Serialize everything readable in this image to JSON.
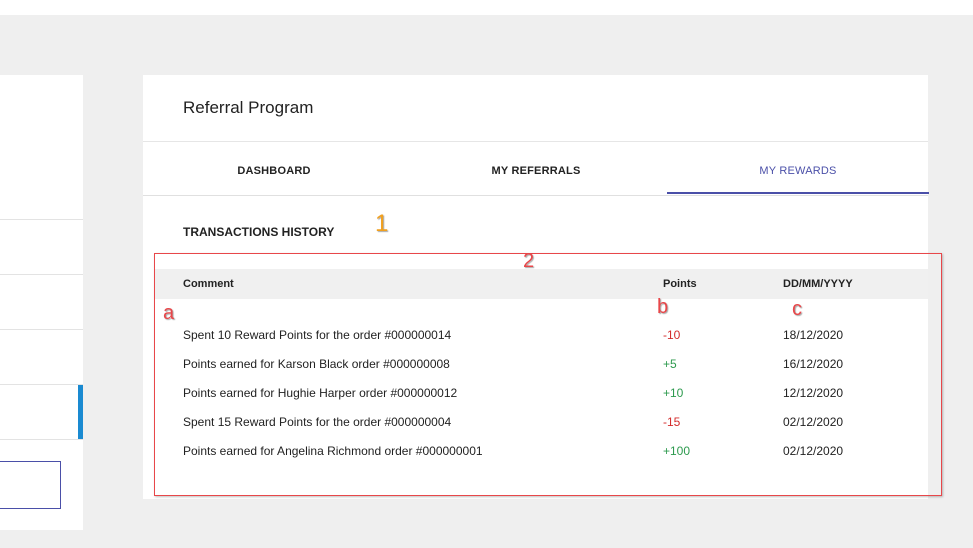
{
  "card": {
    "title": "Referral Program"
  },
  "tabs": [
    {
      "label": "DASHBOARD"
    },
    {
      "label": "MY REFERRALS"
    },
    {
      "label": "MY REWARDS"
    }
  ],
  "section": {
    "title": "TRANSACTIONS HISTORY"
  },
  "table": {
    "headers": {
      "comment": "Comment",
      "points": "Points",
      "date": "DD/MM/YYYY"
    },
    "rows": [
      {
        "comment": "Spent 10 Reward Points for the order #000000014",
        "points": "-10",
        "date": "18/12/2020"
      },
      {
        "comment": "Points earned for Karson Black order #000000008",
        "points": "+5",
        "date": "16/12/2020"
      },
      {
        "comment": "Points earned for Hughie Harper order #000000012",
        "points": "+10",
        "date": "12/12/2020"
      },
      {
        "comment": "Spent 15 Reward Points for the order #000000004",
        "points": "-15",
        "date": "02/12/2020"
      },
      {
        "comment": "Points earned for Angelina Richmond order #000000001",
        "points": "+100",
        "date": "02/12/2020"
      }
    ]
  },
  "annotations": {
    "one": "1",
    "two": "2",
    "a": "a",
    "b": "b",
    "c": "c"
  },
  "colors": {
    "accent": "#4a4fa8",
    "negative": "#d42b2b",
    "positive": "#2d9a4e",
    "annotation_red": "#e8474a",
    "annotation_orange": "#f0a020",
    "sidebar_active": "#1a8ad1"
  }
}
